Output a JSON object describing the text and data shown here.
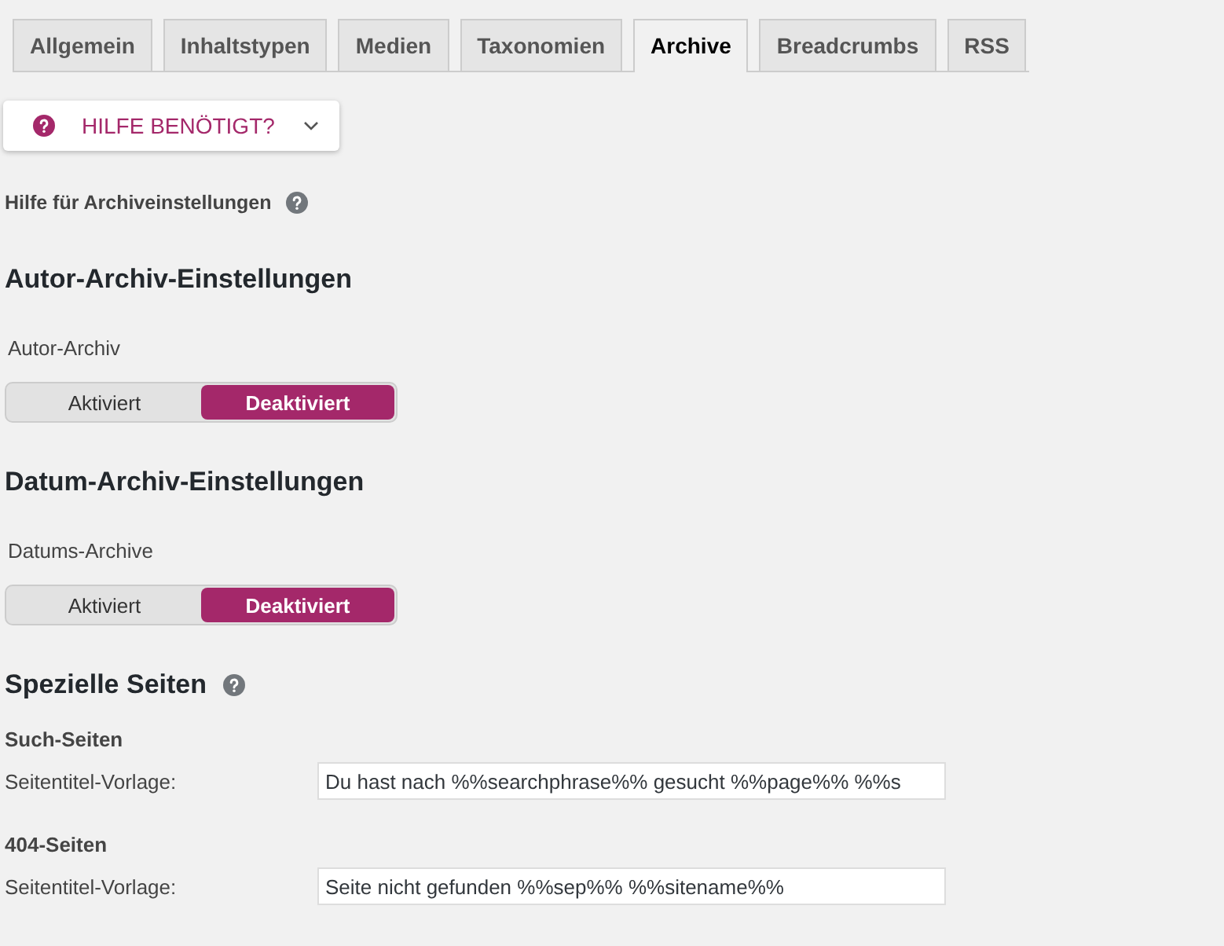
{
  "tabs": [
    {
      "label": "Allgemein",
      "selected": false
    },
    {
      "label": "Inhaltstypen",
      "selected": false
    },
    {
      "label": "Medien",
      "selected": false
    },
    {
      "label": "Taxonomien",
      "selected": false
    },
    {
      "label": "Archive",
      "selected": true
    },
    {
      "label": "Breadcrumbs",
      "selected": false
    },
    {
      "label": "RSS",
      "selected": false
    }
  ],
  "help_button": {
    "label": "HILFE BENÖTIGT?",
    "expanded": false
  },
  "help_link": "Hilfe für Archiveinstellungen",
  "sections": [
    {
      "kind": "toggle",
      "heading": "Autor-Archiv-Einstellungen",
      "label": "Autor-Archiv",
      "options": [
        {
          "label": "Aktiviert",
          "selected": false
        },
        {
          "label": "Deaktiviert",
          "selected": true
        }
      ]
    },
    {
      "kind": "toggle",
      "heading": "Datum-Archiv-Einstellungen",
      "label": "Datums-Archive",
      "options": [
        {
          "label": "Aktiviert",
          "selected": false
        },
        {
          "label": "Deaktiviert",
          "selected": true
        }
      ]
    },
    {
      "kind": "fields",
      "heading": "Spezielle Seiten",
      "groups": [
        {
          "title": "Such-Seiten",
          "label": "Seitentitel-Vorlage:",
          "value": "Du hast nach %%searchphrase%% gesucht %%page%% %%s"
        },
        {
          "title": "404-Seiten",
          "label": "Seitentitel-Vorlage:",
          "value": "Seite nicht gefunden %%sep%% %%sitename%%"
        }
      ]
    }
  ]
}
